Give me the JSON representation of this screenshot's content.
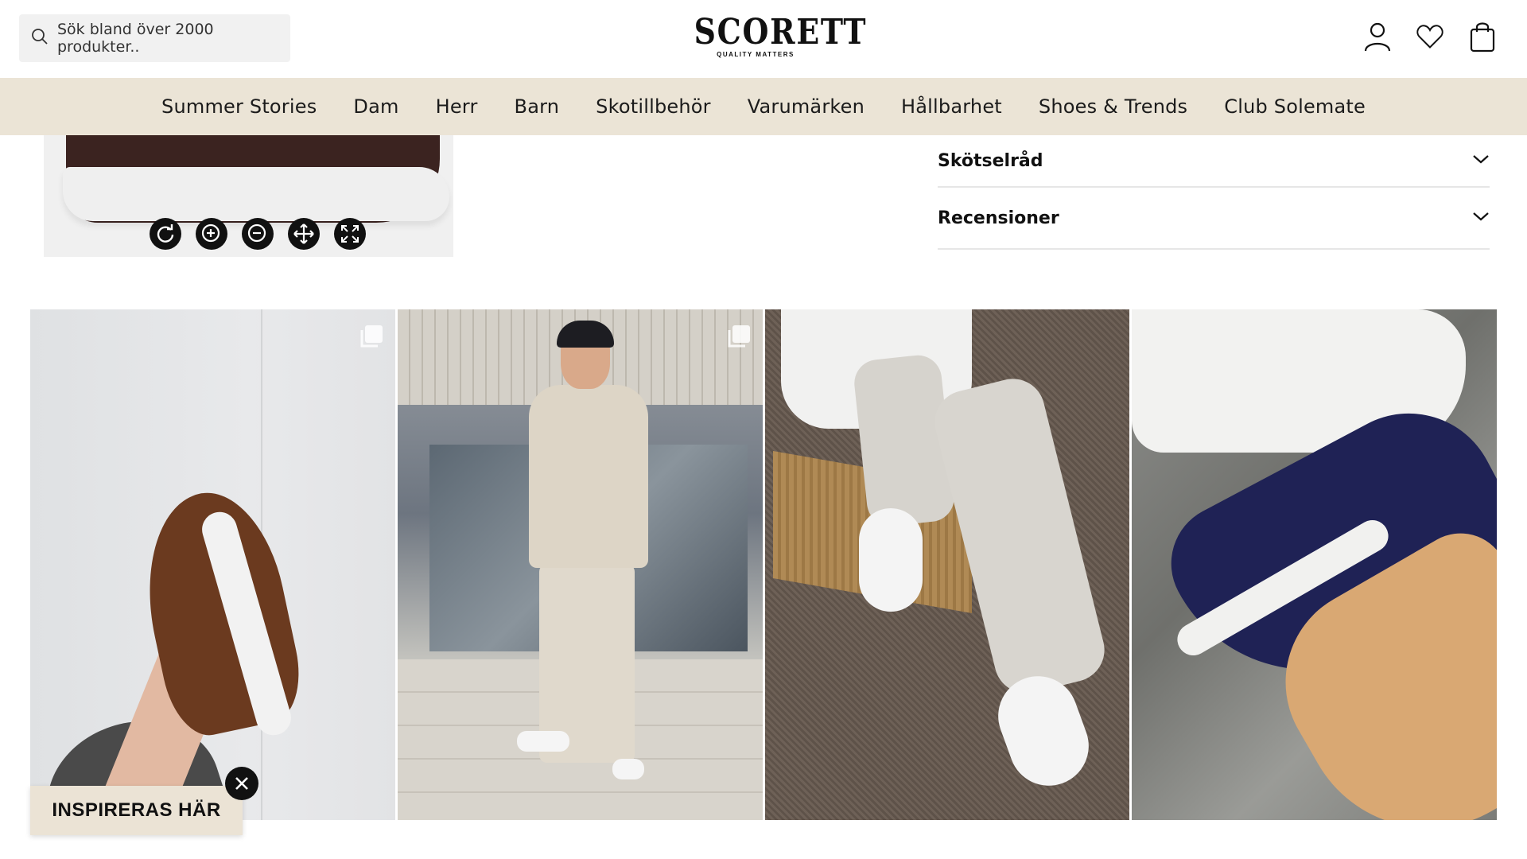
{
  "search": {
    "placeholder": "Sök bland över 2000 produkter.."
  },
  "brand": {
    "logo": "SCORETT",
    "tagline": "QUALITY MATTERS"
  },
  "header_icons": [
    "user-icon",
    "heart-icon",
    "bag-icon"
  ],
  "nav": {
    "items": [
      {
        "label": "Summer Stories"
      },
      {
        "label": "Dam"
      },
      {
        "label": "Herr"
      },
      {
        "label": "Barn"
      },
      {
        "label": "Skotillbehör"
      },
      {
        "label": "Varumärken"
      },
      {
        "label": "Hållbarhet"
      },
      {
        "label": "Shoes & Trends"
      },
      {
        "label": "Club Solemate"
      }
    ]
  },
  "viewer_controls": [
    "rotate-icon",
    "zoom-in-icon",
    "zoom-out-icon",
    "move-icon",
    "fullscreen-icon"
  ],
  "accordion": [
    {
      "label": "Skötselråd"
    },
    {
      "label": "Recensioner"
    }
  ],
  "inspire": {
    "label": "INSPIRERAS HÄR"
  },
  "colors": {
    "nav_bg": "#ebe4d6",
    "search_bg": "#f1f1f1",
    "inspire_bg": "#ebe3d5"
  }
}
